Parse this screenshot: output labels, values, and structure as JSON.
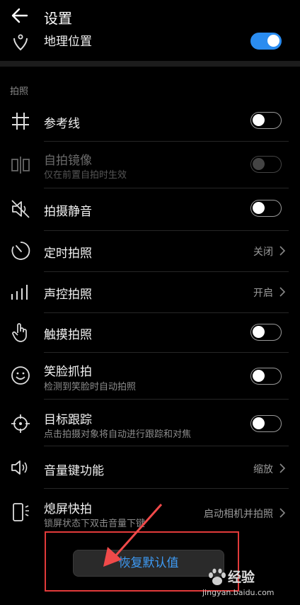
{
  "header": {
    "title": "设置"
  },
  "top_row": {
    "label": "地理位置",
    "toggle_on": true
  },
  "section": {
    "label": "拍照"
  },
  "rows": [
    {
      "title": "参考线",
      "control": "toggle",
      "on": false,
      "icon": "grid-icon"
    },
    {
      "title": "自拍镜像",
      "subtitle": "仅在前置自拍时生效",
      "control": "toggle",
      "on": false,
      "disabled": true,
      "icon": "mirror-icon"
    },
    {
      "title": "拍摄静音",
      "control": "toggle",
      "on": false,
      "icon": "mute-icon"
    },
    {
      "title": "定时拍照",
      "control": "value",
      "value": "关闭",
      "icon": "timer-icon"
    },
    {
      "title": "声控拍照",
      "control": "value",
      "value": "开启",
      "icon": "voice-bars-icon"
    },
    {
      "title": "触摸拍照",
      "control": "toggle",
      "on": false,
      "icon": "touch-hand-icon"
    },
    {
      "title": "笑脸抓拍",
      "subtitle": "检测到笑脸时自动拍照",
      "control": "toggle",
      "on": false,
      "icon": "smile-icon"
    },
    {
      "title": "目标跟踪",
      "subtitle": "点击拍摄对象将自动进行跟踪和对焦",
      "control": "toggle",
      "on": false,
      "icon": "target-icon"
    },
    {
      "title": "音量键功能",
      "control": "value",
      "value": "缩放",
      "icon": "volume-icon"
    },
    {
      "title": "熄屏快拍",
      "subtitle": "锁屏状态下双击音量下键",
      "control": "value",
      "value": "启动相机并拍照",
      "icon": "screen-off-icon"
    }
  ],
  "reset_button": {
    "label": "恢复默认值"
  },
  "watermark": {
    "brand": "经验",
    "url": "jingyan.baidu.com"
  },
  "colors": {
    "accent": "#3e9bf5",
    "toggle_on": "#2a8cf0",
    "annotation": "#e23a3a"
  }
}
